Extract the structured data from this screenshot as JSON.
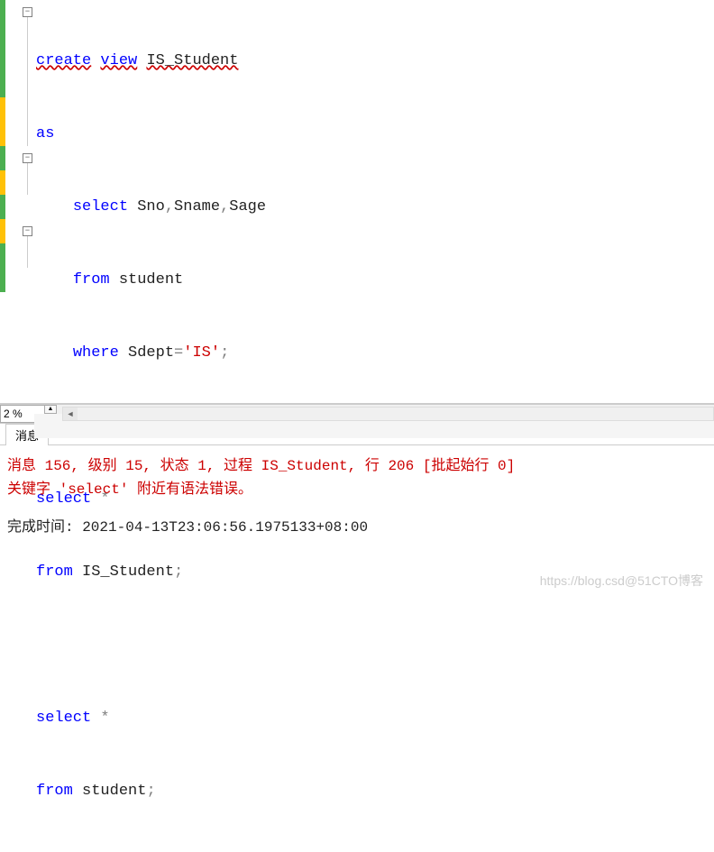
{
  "code": {
    "line1_kw1": "create",
    "line1_kw2": "view",
    "line1_ident": "IS_Student",
    "line2": "as",
    "line3_kw": "select",
    "line3_cols": " Sno",
    "line3_c1": ",",
    "line3_col2": "Sname",
    "line3_c2": ",",
    "line3_col3": "Sage",
    "line4_kw": "from",
    "line4_tbl": " student",
    "line5_kw": "where",
    "line5_col": " Sdept",
    "line5_eq": "=",
    "line5_str": "'IS'",
    "line5_sc": ";",
    "line7_kw": "select",
    "line7_star": " *",
    "line8_kw": "from",
    "line8_tbl": " IS_Student",
    "line8_sc": ";",
    "line10_kw": "select",
    "line10_star": " *",
    "line11_kw": "from",
    "line11_tbl": " student",
    "line11_sc": ";"
  },
  "zoom": {
    "value": "2 %"
  },
  "tabs": {
    "messages": "消息"
  },
  "messages": {
    "error_line1": "消息 156, 级别 15, 状态 1, 过程 IS_Student, 行 206 [批起始行 0]",
    "error_line2": "关键字 'select' 附近有语法错误。",
    "completion": "完成时间: 2021-04-13T23:06:56.1975133+08:00"
  },
  "watermark": "https://blog.csd@51CTO博客"
}
